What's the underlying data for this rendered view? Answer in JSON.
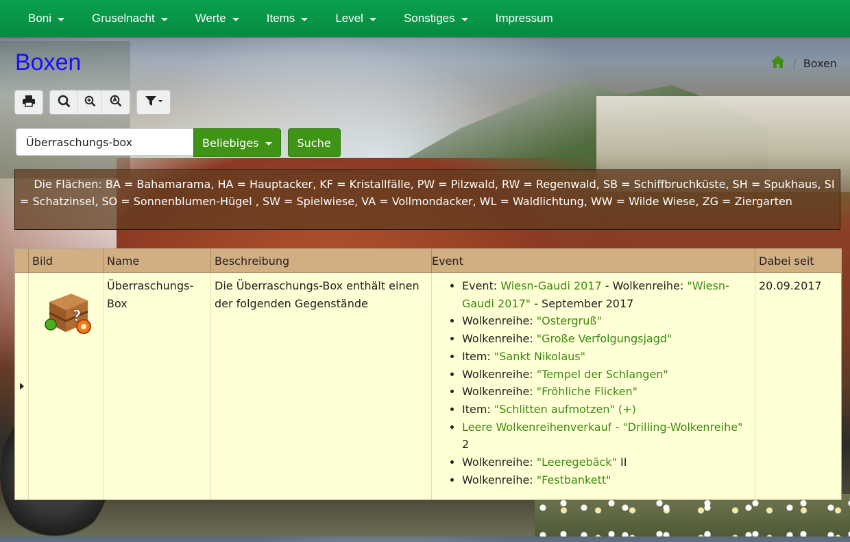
{
  "nav": {
    "items": [
      {
        "label": "Boni",
        "dropdown": true
      },
      {
        "label": "Gruselnacht",
        "dropdown": true
      },
      {
        "label": "Werte",
        "dropdown": true
      },
      {
        "label": "Items",
        "dropdown": true
      },
      {
        "label": "Level",
        "dropdown": true
      },
      {
        "label": "Sonstiges",
        "dropdown": true
      },
      {
        "label": "Impressum",
        "dropdown": false
      }
    ]
  },
  "page": {
    "title": "Boxen"
  },
  "breadcrumb": {
    "home_icon": "home-icon",
    "separator": "/",
    "current": "Boxen"
  },
  "toolbar": {
    "icons": [
      "print-icon",
      "search-icon",
      "zoom-in-icon",
      "zoom-reset-icon",
      "filter-icon"
    ]
  },
  "search": {
    "value": "Überraschungs-box",
    "dropdown_label": "Beliebiges",
    "button_label": "Suche"
  },
  "legend": {
    "text": "Die Flächen: BA = Bahamarama, HA = Hauptacker, KF = Kristallfälle, PW = Pilzwald, RW = Regenwald, SB = Schiffbruchküste, SH = Spukhaus, SI = Schatzinsel, SO = Sonnenblumen-Hügel , SW = Spielwiese, VA = Vollmondacker, WL = Waldlichtung, WW = Wilde Wiese, ZG = Ziergarten"
  },
  "table": {
    "headers": {
      "bild": "Bild",
      "name": "Name",
      "beschreibung": "Beschreibung",
      "event": "Event",
      "dabei_seit": "Dabei seit"
    },
    "row": {
      "name": "Überraschungs-Box",
      "beschreibung": "Die Überraschungs-Box enthält einen der folgenden Gegenstände",
      "dabei_seit": "20.09.2017",
      "events": [
        {
          "prefix": "Event: ",
          "parts": [
            {
              "text": "Wiesn-Gaudi 2017",
              "link": true
            },
            {
              "text": " - Wolkenreihe: ",
              "link": false
            },
            {
              "text": "\"Wiesn-Gaudi 2017\"",
              "link": true
            },
            {
              "text": " - September 2017",
              "link": false
            }
          ]
        },
        {
          "prefix": "Wolkenreihe: ",
          "parts": [
            {
              "text": "\"Ostergruß\"",
              "link": true
            }
          ]
        },
        {
          "prefix": "Wolkenreihe: ",
          "parts": [
            {
              "text": "\"Große Verfolgungsjagd\"",
              "link": true
            }
          ]
        },
        {
          "prefix": "Item: ",
          "parts": [
            {
              "text": "\"Sankt Nikolaus\"",
              "link": true
            }
          ]
        },
        {
          "prefix": "Wolkenreihe: ",
          "parts": [
            {
              "text": "\"Tempel der Schlangen\"",
              "link": true
            }
          ]
        },
        {
          "prefix": "Wolkenreihe: ",
          "parts": [
            {
              "text": "\"Fröhliche Flicken\"",
              "link": true
            }
          ]
        },
        {
          "prefix": "Item: ",
          "parts": [
            {
              "text": "\"Schlitten aufmotzen\" (+)",
              "link": true
            }
          ]
        },
        {
          "prefix": "",
          "parts": [
            {
              "text": "Leere Wolkenreihenverkauf - \"Drilling-Wolkenreihe\"",
              "link": true
            },
            {
              "text": " 2",
              "link": false
            }
          ]
        },
        {
          "prefix": "Wolkenreihe: ",
          "parts": [
            {
              "text": "\"Leeregebäck\"",
              "link": true
            },
            {
              "text": " II",
              "link": false
            }
          ]
        },
        {
          "prefix": "Wolkenreihe: ",
          "parts": [
            {
              "text": "\"Festbankett\"",
              "link": true
            }
          ]
        }
      ]
    }
  },
  "colors": {
    "navbar": "#0aa04f",
    "title": "#1a0dff",
    "button_green": "#3f9416",
    "link": "#3a8a10",
    "table_header": "#d2ae83",
    "table_body": "#ffffd6"
  }
}
